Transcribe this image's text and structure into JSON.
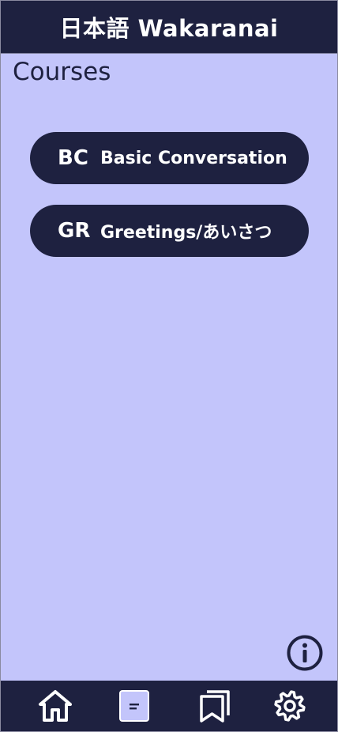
{
  "app": {
    "title": "日本語 Wakaranai"
  },
  "main": {
    "section_title": "Courses",
    "courses": [
      {
        "code": "BC",
        "name": "Basic Conversation"
      },
      {
        "code": "GR",
        "name": "Greetings/あいさつ"
      }
    ]
  },
  "bottom_nav": {
    "items": [
      {
        "icon": "home-icon",
        "active": false
      },
      {
        "icon": "courses-icon",
        "active": true
      },
      {
        "icon": "bookmarks-icon",
        "active": false
      },
      {
        "icon": "settings-icon",
        "active": false
      }
    ]
  },
  "floating": {
    "icon": "info-icon"
  },
  "colors": {
    "navy": "#1e2140",
    "background": "#c3c5fb",
    "active_icon_fill": "#c3c5fb",
    "text_on_dark": "#ffffff"
  }
}
